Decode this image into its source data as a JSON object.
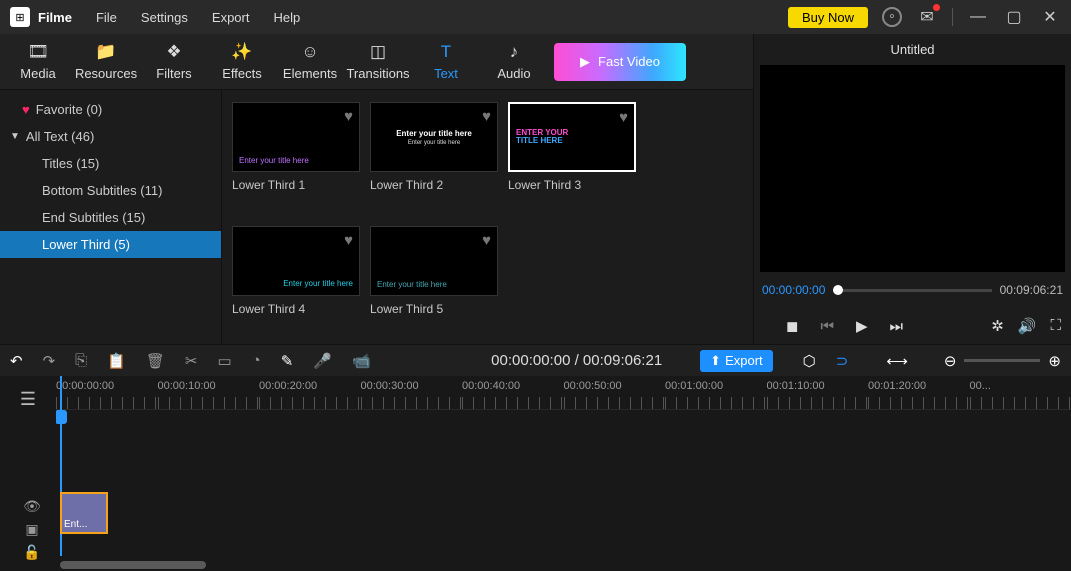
{
  "app": {
    "name": "Filme"
  },
  "menu": {
    "file": "File",
    "settings": "Settings",
    "export": "Export",
    "help": "Help"
  },
  "titlebar": {
    "buy": "Buy Now"
  },
  "tabs": {
    "media": "Media",
    "resources": "Resources",
    "filters": "Filters",
    "effects": "Effects",
    "elements": "Elements",
    "transitions": "Transitions",
    "text": "Text",
    "audio": "Audio",
    "fast": "Fast Video"
  },
  "tree": {
    "favorite": "Favorite (0)",
    "alltext": "All Text (46)",
    "titles": "Titles (15)",
    "bottom": "Bottom Subtitles (11)",
    "end": "End Subtitles (15)",
    "lowerthird": "Lower Third (5)"
  },
  "thumbs": {
    "lt1": {
      "label": "Lower Third 1",
      "sample": "Enter your title here"
    },
    "lt2": {
      "label": "Lower Third 2",
      "sample": "Enter your title here",
      "sub": "Enter your title here"
    },
    "lt3": {
      "label": "Lower Third 3",
      "line1": "ENTER YOUR",
      "line2": "TITLE HERE"
    },
    "lt4": {
      "label": "Lower Third 4",
      "sample": "Enter your title here"
    },
    "lt5": {
      "label": "Lower Third 5",
      "sample": "Enter your title here"
    }
  },
  "preview": {
    "title": "Untitled",
    "time_cur": "00:00:00:00",
    "time_end": "00:09:06:21"
  },
  "timeline": {
    "display": "00:00:00:00 / 00:09:06:21",
    "export": "Export",
    "ruler": [
      "00:00:00:00",
      "00:00:10:00",
      "00:00:20:00",
      "00:00:30:00",
      "00:00:40:00",
      "00:00:50:00",
      "00:01:00:00",
      "00:01:10:00",
      "00:01:20:00",
      "00..."
    ],
    "clip": "Ent..."
  }
}
